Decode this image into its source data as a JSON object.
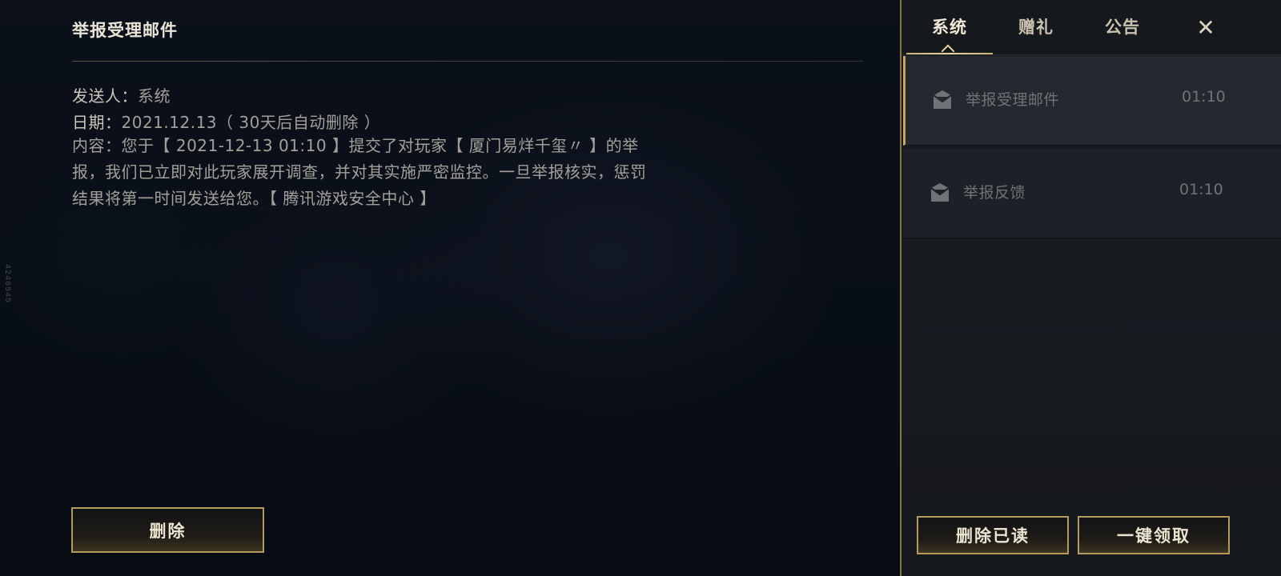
{
  "detail": {
    "title": "举报受理邮件",
    "sender_label": "发送人：",
    "sender_value": "系统",
    "date_label": "日期：",
    "date_value": "2021.12.13（ 30天后自动删除 ）",
    "content": "内容：您于【 2021-12-13 01:10 】提交了对玩家【 厦门易烊千玺〃 】的举报，我们已立即对此玩家展开调查，并对其实施严密监控。一旦举报核实，惩罚结果将第一时间发送给您。【 腾讯游戏安全中心 】",
    "delete_button": "删除"
  },
  "watermark": "4240545",
  "tabs": [
    {
      "label": "系统",
      "active": true
    },
    {
      "label": "赠礼",
      "active": false
    },
    {
      "label": "公告",
      "active": false
    }
  ],
  "close_glyph": "✕",
  "mail_list": [
    {
      "title": "举报受理邮件",
      "time": "01:10",
      "selected": true,
      "icon": "mail-icon"
    },
    {
      "title": "举报反馈",
      "time": "01:10",
      "selected": false,
      "icon": "mail-icon"
    }
  ],
  "footer_buttons": {
    "delete_read": "删除已读",
    "claim_all": "一键领取"
  },
  "colors": {
    "accent_gold": "#b69a5b",
    "panel_bg": "#181b21",
    "text_primary": "#e9e4d6",
    "text_secondary": "#a3a09a"
  }
}
